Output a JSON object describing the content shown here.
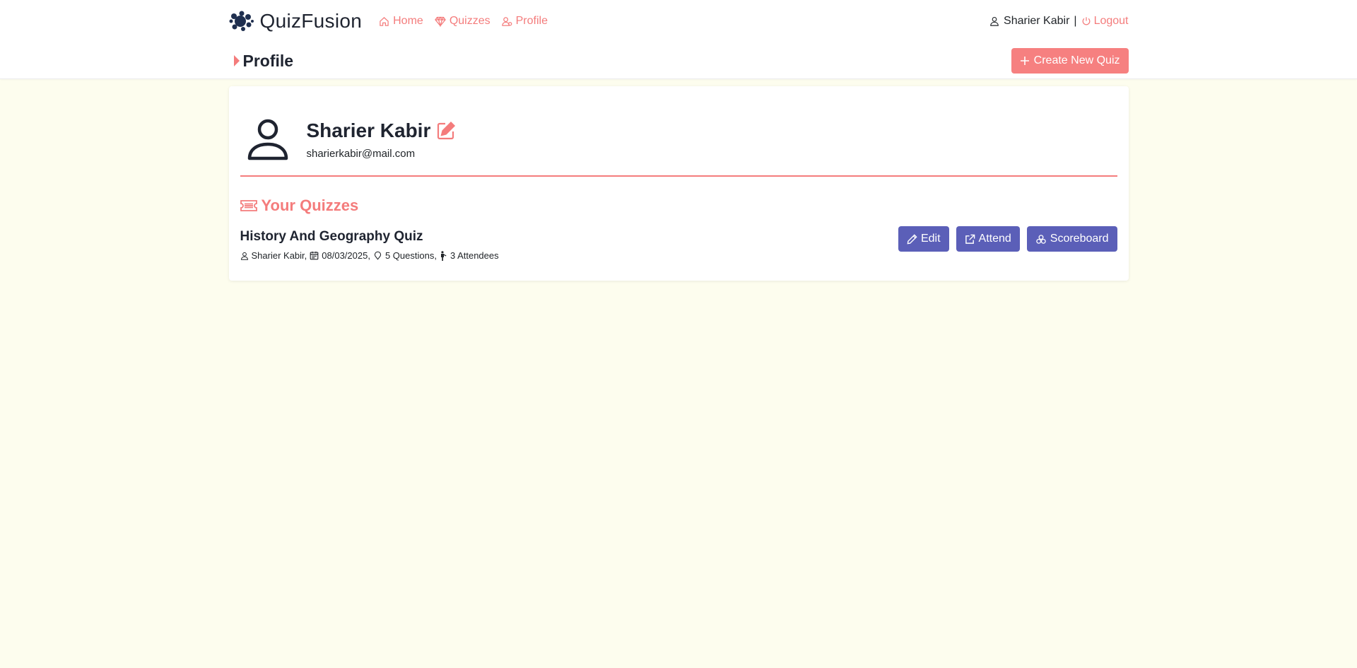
{
  "brand": {
    "name": "QuizFusion"
  },
  "nav": {
    "links": [
      {
        "label": "Home",
        "icon": "home-icon"
      },
      {
        "label": "Quizzes",
        "icon": "gem-icon"
      },
      {
        "label": "Profile",
        "icon": "profile-icon"
      }
    ],
    "user_name": "Sharier Kabir",
    "separator": "|",
    "logout_label": "Logout"
  },
  "page": {
    "title": "Profile",
    "create_label": "Create New Quiz"
  },
  "profile": {
    "name": "Sharier Kabir",
    "email": "sharierkabir@mail.com"
  },
  "quizzes": {
    "section_title": "Your Quizzes",
    "items": [
      {
        "title": "History And Geography Quiz",
        "author": "Sharier Kabir,",
        "date": "08/03/2025,",
        "questions": "5 Questions,",
        "attendees": "3 Attendees",
        "edit_label": "Edit",
        "attend_label": "Attend",
        "scoreboard_label": "Scoreboard"
      }
    ]
  },
  "colors": {
    "accent": "#f47c7c",
    "primary_button": "#5b5fb8",
    "background": "#fdfdee",
    "brand_dark": "#1f2f4f"
  }
}
